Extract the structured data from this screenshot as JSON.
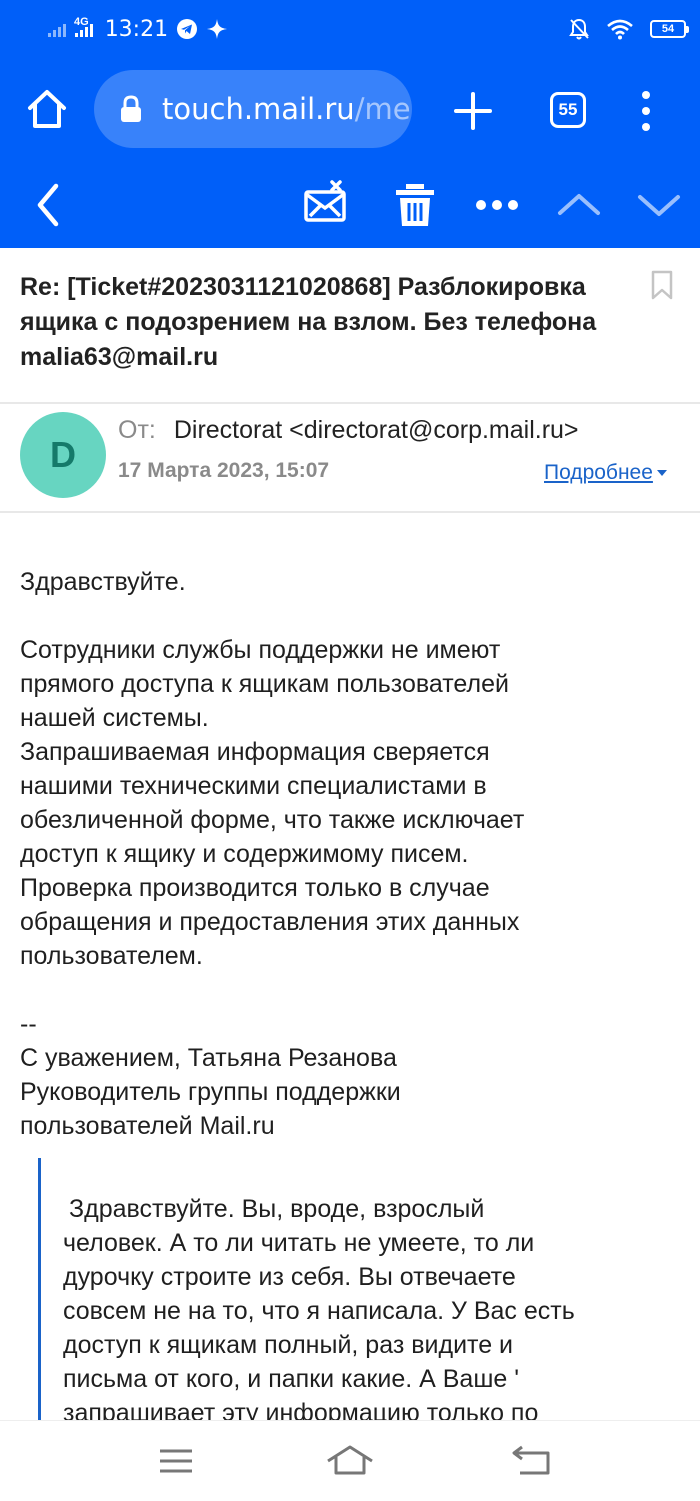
{
  "status_bar": {
    "network": "4G",
    "time": "13:21",
    "battery": "54"
  },
  "browser": {
    "url_main": "touch.mail.ru",
    "url_dim": "/me",
    "tab_count": "55"
  },
  "message": {
    "subject": "Re: [Ticket#2023031121020868] Разблокировка ящика с подозрением на взлом. Без телефона malia63@mail.ru",
    "avatar_letter": "D",
    "from_label": "От:",
    "from_value": "Directorat <directorat@corp.mail.ru>",
    "date": "17 Марта 2023, 15:07",
    "details_link": "Подробнее",
    "body": {
      "greeting": "Здравствуйте.",
      "para1_l1": "Сотрудники службы поддержки не имеют",
      "para1_l2": "прямого доступа к ящикам пользователей",
      "para1_l3": "нашей системы.",
      "para1_l4": "Запрашиваемая информация сверяется",
      "para1_l5": "нашими техническими специалистами в",
      "para1_l6": "обезличенной форме, что также исключает",
      "para1_l7": "доступ к ящику и содержимому писем.",
      "para1_l8": "Проверка производится только в случае",
      "para1_l9": "обращения и предоставления этих данных",
      "para1_l10": "пользователем.",
      "sig_dash": "--",
      "sig_l1": "С уважением, Татьяна Резанова",
      "sig_l2": "Руководитель группы поддержки",
      "sig_l3": "пользователей Mail.ru"
    },
    "quote": {
      "l1": "Здравствуйте. Вы, вроде, взрослый",
      "l2": "человек. А то ли читать не умеете, то ли",
      "l3": "дурочку строите из себя. Вы отвечаете",
      "l4": "совсем не на то, что я написала. У Вас есть",
      "l5": "доступ к ящикам полный, раз видите и",
      "l6": "письма от кого, и папки какие. А Ваше '",
      "l7": "запрашивает эту информацию только по"
    }
  },
  "icons": {
    "home": "home-icon",
    "lock": "lock-icon",
    "plus": "plus-icon",
    "menu": "more-vertical-icon",
    "back": "chevron-left-icon",
    "spam": "mail-block-icon",
    "delete": "trash-icon",
    "more": "more-horizontal-icon",
    "prev": "chevron-up-icon",
    "next": "chevron-down-icon",
    "bookmark": "bookmark-icon"
  },
  "colors": {
    "accent": "#005ff9",
    "avatar_bg": "#67d5c1",
    "link": "#1a63c9"
  }
}
